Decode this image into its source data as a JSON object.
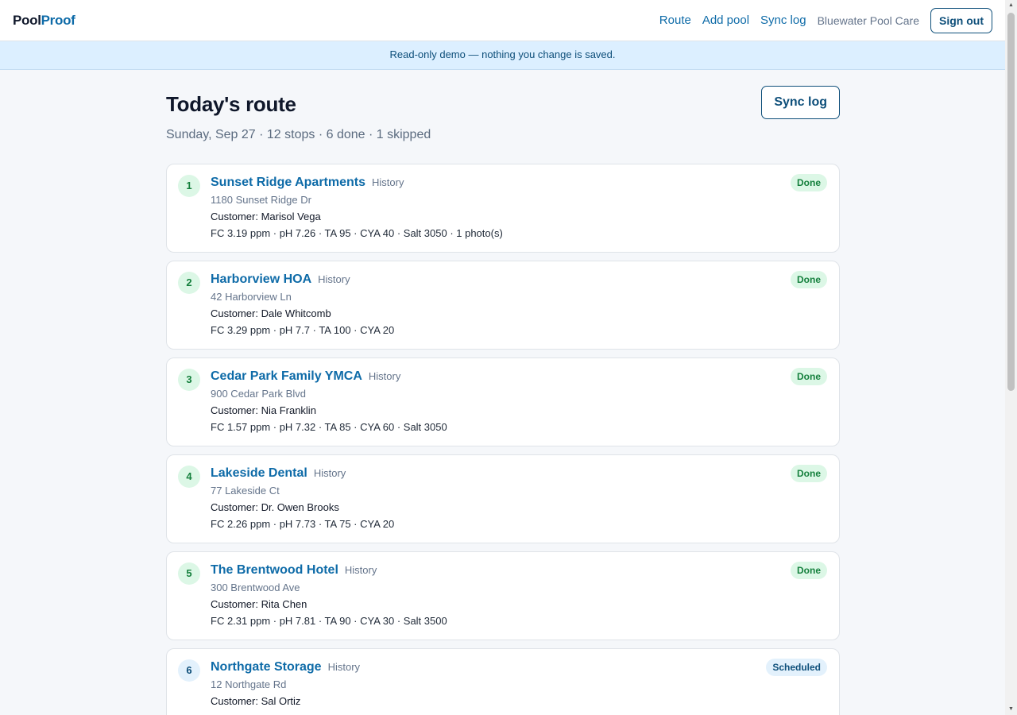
{
  "app": {
    "brand_part1": "Pool",
    "brand_part2": "Proof"
  },
  "nav": {
    "route": "Route",
    "add_pool": "Add pool",
    "sync_log": "Sync log",
    "org": "Bluewater Pool Care",
    "sign_out": "Sign out"
  },
  "banner": "Read-only demo — nothing you change is saved.",
  "page": {
    "title": "Today's route",
    "subtitle": "Sunday, Sep 27 · 12 stops · 6 done · 1 skipped",
    "sync_button": "Sync log"
  },
  "stops": [
    {
      "num": "1",
      "name": "Sunset Ridge Apartments",
      "history": "History",
      "address": "1180 Sunset Ridge Dr",
      "customer": "Customer: Marisol Vega",
      "chem": "FC 3.19 ppm · pH 7.26 · TA 95 · CYA 40 · Salt 3050 · 1 photo(s)",
      "status": "Done"
    },
    {
      "num": "2",
      "name": "Harborview HOA",
      "history": "History",
      "address": "42 Harborview Ln",
      "customer": "Customer: Dale Whitcomb",
      "chem": "FC 3.29 ppm · pH 7.7 · TA 100 · CYA 20",
      "status": "Done"
    },
    {
      "num": "3",
      "name": "Cedar Park Family YMCA",
      "history": "History",
      "address": "900 Cedar Park Blvd",
      "customer": "Customer: Nia Franklin",
      "chem": "FC 1.57 ppm · pH 7.32 · TA 85 · CYA 60 · Salt 3050",
      "status": "Done"
    },
    {
      "num": "4",
      "name": "Lakeside Dental",
      "history": "History",
      "address": "77 Lakeside Ct",
      "customer": "Customer: Dr. Owen Brooks",
      "chem": "FC 2.26 ppm · pH 7.73 · TA 75 · CYA 20",
      "status": "Done"
    },
    {
      "num": "5",
      "name": "The Brentwood Hotel",
      "history": "History",
      "address": "300 Brentwood Ave",
      "customer": "Customer: Rita Chen",
      "chem": "FC 2.31 ppm · pH 7.81 · TA 90 · CYA 30 · Salt 3500",
      "status": "Done"
    },
    {
      "num": "6",
      "name": "Northgate Storage",
      "history": "History",
      "address": "12 Northgate Rd",
      "customer": "Customer: Sal Ortiz",
      "chem": "",
      "status": "Scheduled"
    }
  ],
  "colors": {
    "brand_blue": "#0e6ba8",
    "done_bg": "#dcf7e6",
    "done_text": "#15803d",
    "scheduled_bg": "#e3f1fc",
    "scheduled_text": "#0e4f7a",
    "banner_bg": "#dcefff"
  }
}
